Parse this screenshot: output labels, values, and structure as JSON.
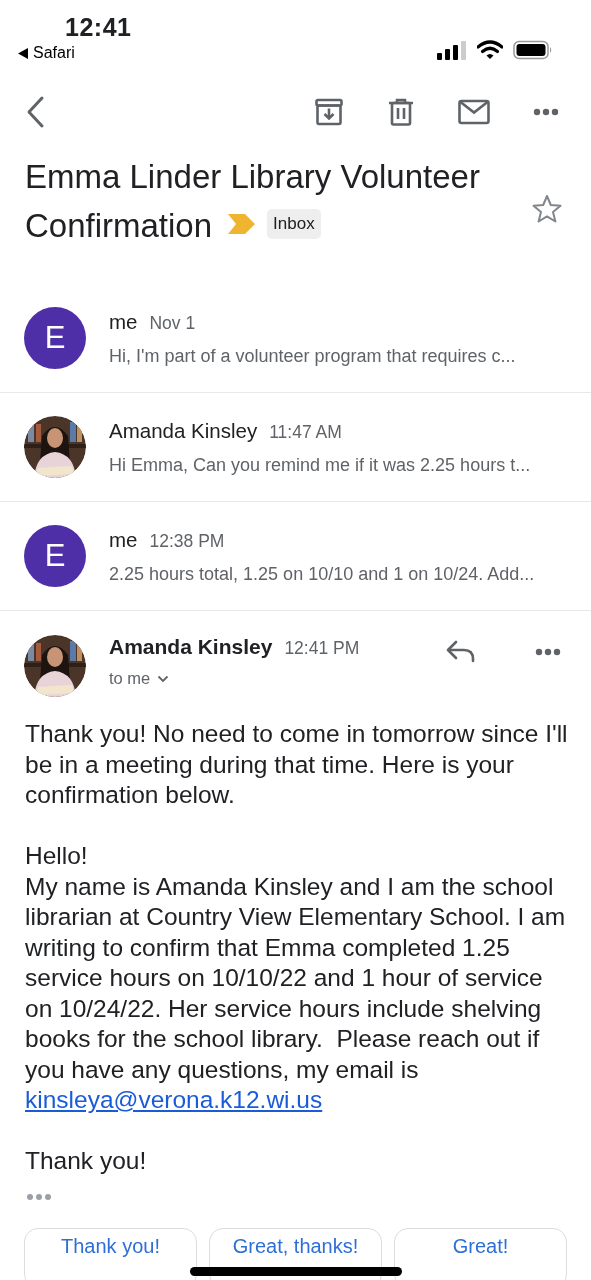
{
  "status_bar": {
    "time": "12:41",
    "back_app": "Safari"
  },
  "subject": {
    "title": "Emma Linder Library Volunteer Confirmation",
    "important": true,
    "label": "Inbox",
    "starred": false
  },
  "thread": [
    {
      "sender": "me",
      "time": "Nov 1",
      "preview": "Hi, I'm part of a volunteer program that requires c...",
      "avatar": {
        "kind": "letter",
        "letter": "E",
        "color": "#4e2fa8"
      }
    },
    {
      "sender": "Amanda Kinsley",
      "time": "11:47 AM",
      "preview": "Hi Emma, Can you remind me if it was 2.25 hours t..."
    },
    {
      "sender": "me",
      "time": "12:38 PM",
      "preview": "2.25 hours total, 1.25 on 10/10 and 1 on 10/24. Add...",
      "avatar": {
        "kind": "letter",
        "letter": "E",
        "color": "#4e2fa8"
      }
    }
  ],
  "open_message": {
    "sender": "Amanda Kinsley",
    "time": "12:41 PM",
    "recipient": "to me",
    "body": [
      {
        "kind": "text",
        "text": "Thank you! No need to come in tomorrow since I'll be in a meeting during that time. Here is your confirmation below."
      },
      {
        "kind": "gap"
      },
      {
        "kind": "text",
        "text": "Hello!"
      },
      {
        "kind": "text",
        "text": "My name is Amanda Kinsley and I am the school librarian at Country View Elementary School. I am writing to confirm that Emma completed 1.25 service hours on 10/10/22 and 1 hour of service on 10/24/22. Her service hours include shelving books for the school library.  Please reach out if you have any questions, my email is"
      },
      {
        "kind": "link",
        "text": "kinsleya@verona.k12.wi.us"
      },
      {
        "kind": "gap"
      },
      {
        "kind": "text",
        "text": "Thank you!"
      }
    ]
  },
  "smart_replies": [
    "Thank you!",
    "Great, thanks!",
    "Great!"
  ]
}
